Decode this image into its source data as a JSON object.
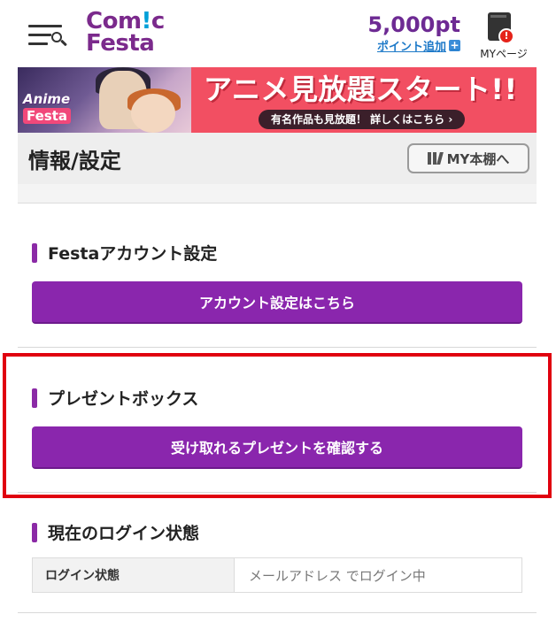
{
  "header": {
    "logo_line1": "Com",
    "logo_excl": "!",
    "logo_line1_end": "c",
    "logo_line2": "Festa",
    "points_value": "5,000pt",
    "points_add_label": "ポイント追加",
    "points_add_icon": "+",
    "mypage_label": "MYページ",
    "mypage_badge": "!"
  },
  "banner": {
    "logo_line1": "Anime",
    "logo_line2": "Festa",
    "headline": "アニメ見放題スタート!!",
    "sub": "有名作品も見放題！ 詳しくはこちら ›"
  },
  "title_bar": {
    "title": "情報/設定",
    "shelf_button": "MY本棚へ"
  },
  "sections": {
    "account": {
      "heading": "Festaアカウント設定",
      "button": "アカウント設定はこちら"
    },
    "present": {
      "heading": "プレゼントボックス",
      "button": "受け取れるプレゼントを確認する"
    },
    "login": {
      "heading": "現在のログイン状態",
      "row_label": "ログイン状態",
      "row_value": "メールアドレス でログイン中"
    }
  },
  "colors": {
    "brand_purple": "#8a26ad",
    "highlight_red": "#e0000f",
    "banner_pink": "#f24f62"
  }
}
